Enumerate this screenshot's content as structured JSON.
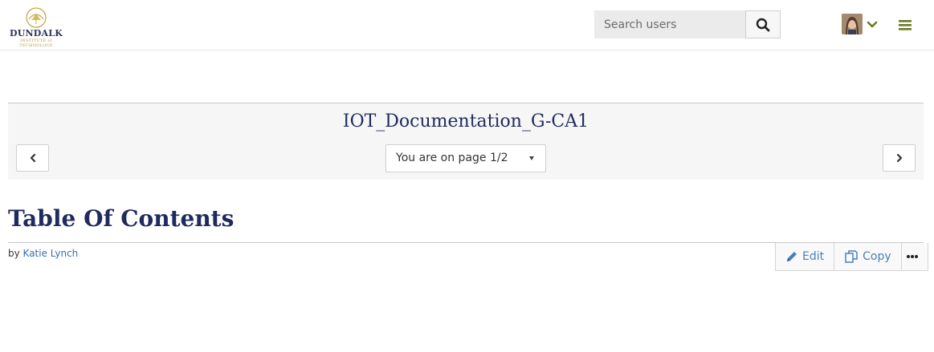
{
  "header": {
    "logo_name": "DUNDALK",
    "logo_tagline": "INSTITUTE of TECHNOLOGY",
    "search": {
      "placeholder": "Search users"
    },
    "accent_color": "#6b7a27"
  },
  "navband": {
    "title": "IOT_Documentation_G-CA1",
    "page_select": "You are on page 1/2"
  },
  "page": {
    "heading": "Table Of Contents",
    "by_prefix": "by",
    "author": "Katie Lynch",
    "actions": {
      "edit": "Edit",
      "copy": "Copy"
    }
  },
  "icons": [
    "search-icon",
    "avatar",
    "chevron-down-icon",
    "menu-icon",
    "chevron-left-icon",
    "chevron-right-icon",
    "pencil-icon",
    "copy-icon",
    "more-icon"
  ]
}
